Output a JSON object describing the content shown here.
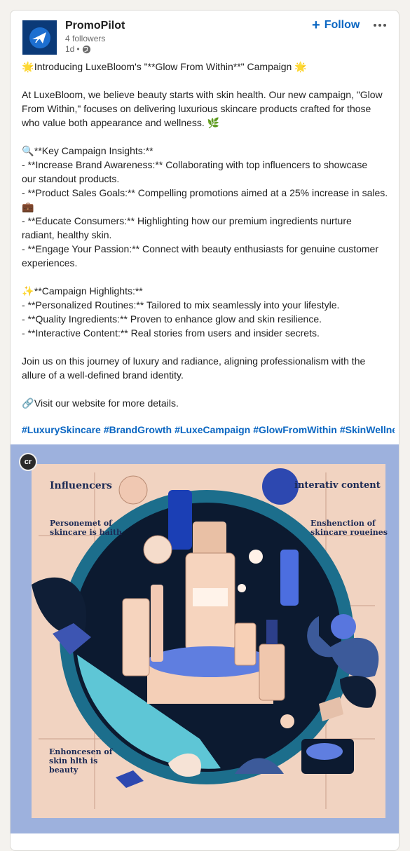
{
  "author": {
    "name": "PromoPilot",
    "followers": "4 followers",
    "time": "1d",
    "separator": "•"
  },
  "actions": {
    "follow_label": "Follow",
    "follow_icon": "plus-icon",
    "more_icon": "more-horizontal-icon"
  },
  "post": {
    "lines": [
      {
        "emoji": "🌟",
        "text": " Introducing LuxeBloom's \"**Glow From Within**\" Campaign ",
        "emoji_end": "🌟"
      },
      {
        "text": ""
      },
      {
        "text": "At LuxeBloom, we believe beauty starts with skin health. Our new campaign, \"Glow"
      },
      {
        "text": "From Within,\" focuses on delivering luxurious skincare products crafted for those"
      },
      {
        "text": "who value both appearance and wellness. ",
        "emoji_end": "🌿"
      },
      {
        "text": ""
      },
      {
        "emoji": "🔍",
        "text": " **Key Campaign Insights:**"
      },
      {
        "text": "- **Increase Brand Awareness:** Collaborating with top influencers to showcase"
      },
      {
        "text": "our standout products."
      },
      {
        "text": "- **Product Sales Goals:** Compelling promotions aimed at a 25% increase in sales."
      },
      {
        "emoji": "💼",
        "text": ""
      },
      {
        "text": "- **Educate Consumers:** Highlighting how our premium ingredients nurture"
      },
      {
        "text": "radiant, healthy skin."
      },
      {
        "text": "- **Engage Your Passion:** Connect with beauty enthusiasts for genuine customer"
      },
      {
        "text": "experiences."
      },
      {
        "text": ""
      },
      {
        "emoji": "✨",
        "text": " **Campaign Highlights:**"
      },
      {
        "text": "- **Personalized Routines:** Tailored to mix seamlessly into your lifestyle."
      },
      {
        "text": "- **Quality Ingredients:** Proven to enhance glow and skin resilience."
      },
      {
        "text": "- **Interactive Content:** Real stories from users and insider secrets."
      },
      {
        "text": ""
      },
      {
        "text": "Join us on this journey of luxury and radiance, aligning professionalism with the"
      },
      {
        "text": "allure of a well-defined brand identity."
      },
      {
        "text": ""
      },
      {
        "emoji": "🔗",
        "text": " Visit our website for more details."
      }
    ],
    "hashtags": [
      "#LuxurySkincare",
      "#BrandGrowth",
      "#LuxeCampaign",
      "#GlowFromWithin",
      "#SkinWellne"
    ]
  },
  "image": {
    "badge": "cr",
    "labels": {
      "top_left": "Influencers",
      "top_right": "interativ content",
      "mid_left": "Personemet of skincare is haith",
      "mid_right": "Enshenction of skincare roueines",
      "bottom_left": "Enhoncesen of skin hlth is beauty"
    }
  },
  "colors": {
    "accent": "#0a66c2",
    "avatar_bg": "#0b3a78",
    "image_bg": "#9db1dd"
  }
}
